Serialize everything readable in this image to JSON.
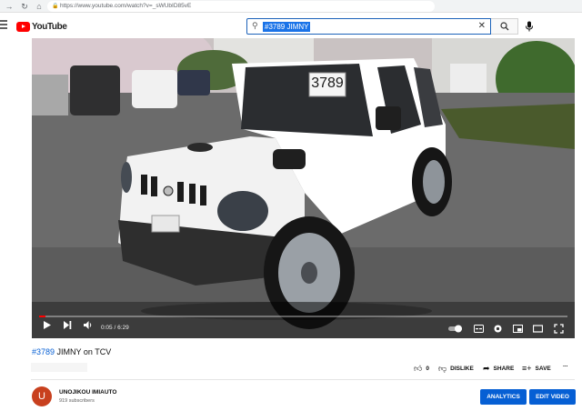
{
  "browser": {
    "url": "https://www.youtube.com/watch?v=_sWUbID85vE"
  },
  "header": {
    "logo_text": "YouTube",
    "search_value": "#3789 JIMNY"
  },
  "video": {
    "plate_number": "3789",
    "time_current": "0:05",
    "time_separator": " / ",
    "time_total": "6:29",
    "progress_fraction": 0.0129,
    "title_tag": "#3789",
    "title_rest": " JIMNY on TCV"
  },
  "actions": {
    "like_count": "0",
    "dislike_label": "DISLIKE",
    "share_label": "SHARE",
    "save_label": "SAVE",
    "more_label": "..."
  },
  "channel": {
    "avatar_letter": "U",
    "name": "UNOJIKOU IMIAUTO",
    "subscribers": "919 subscribers"
  },
  "buttons": {
    "analytics": "ANALYTICS",
    "edit_video": "EDIT VIDEO"
  }
}
